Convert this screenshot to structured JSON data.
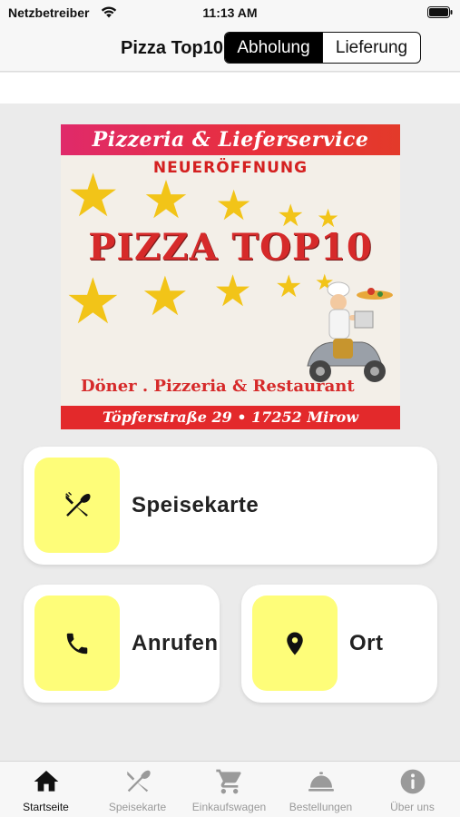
{
  "status_bar": {
    "carrier": "Netzbetreiber",
    "time": "11:13 AM"
  },
  "nav": {
    "title": "Pizza Top10",
    "segments": [
      "Abholung",
      "Lieferung"
    ],
    "selected": "Abholung"
  },
  "banner": {
    "top_text": "Pizzeria & Lieferservice",
    "subtitle": "NEUERÖFFNUNG",
    "name": "PIZZA TOP10",
    "services": "Döner . Pizzeria & Restaurant",
    "address": "Töpferstraße 29 • 17252 Mirow"
  },
  "cards": {
    "menu": {
      "label": "Speisekarte",
      "icon": "fork-knife-icon"
    },
    "call": {
      "label": "Anrufen",
      "icon": "phone-icon"
    },
    "location": {
      "label": "Ort",
      "icon": "location-pin-icon"
    }
  },
  "tabs": [
    {
      "label": "Startseite",
      "icon": "home-icon",
      "active": true
    },
    {
      "label": "Speisekarte",
      "icon": "fork-knife-icon",
      "active": false
    },
    {
      "label": "Einkaufswagen",
      "icon": "cart-icon",
      "active": false
    },
    {
      "label": "Bestellungen",
      "icon": "cloche-icon",
      "active": false
    },
    {
      "label": "Über uns",
      "icon": "info-icon",
      "active": false
    }
  ],
  "colors": {
    "accent_yellow": "#fefd79",
    "banner_red": "#e3292b",
    "star_yellow": "#f2c418",
    "tab_inactive": "#9a9a9a"
  }
}
